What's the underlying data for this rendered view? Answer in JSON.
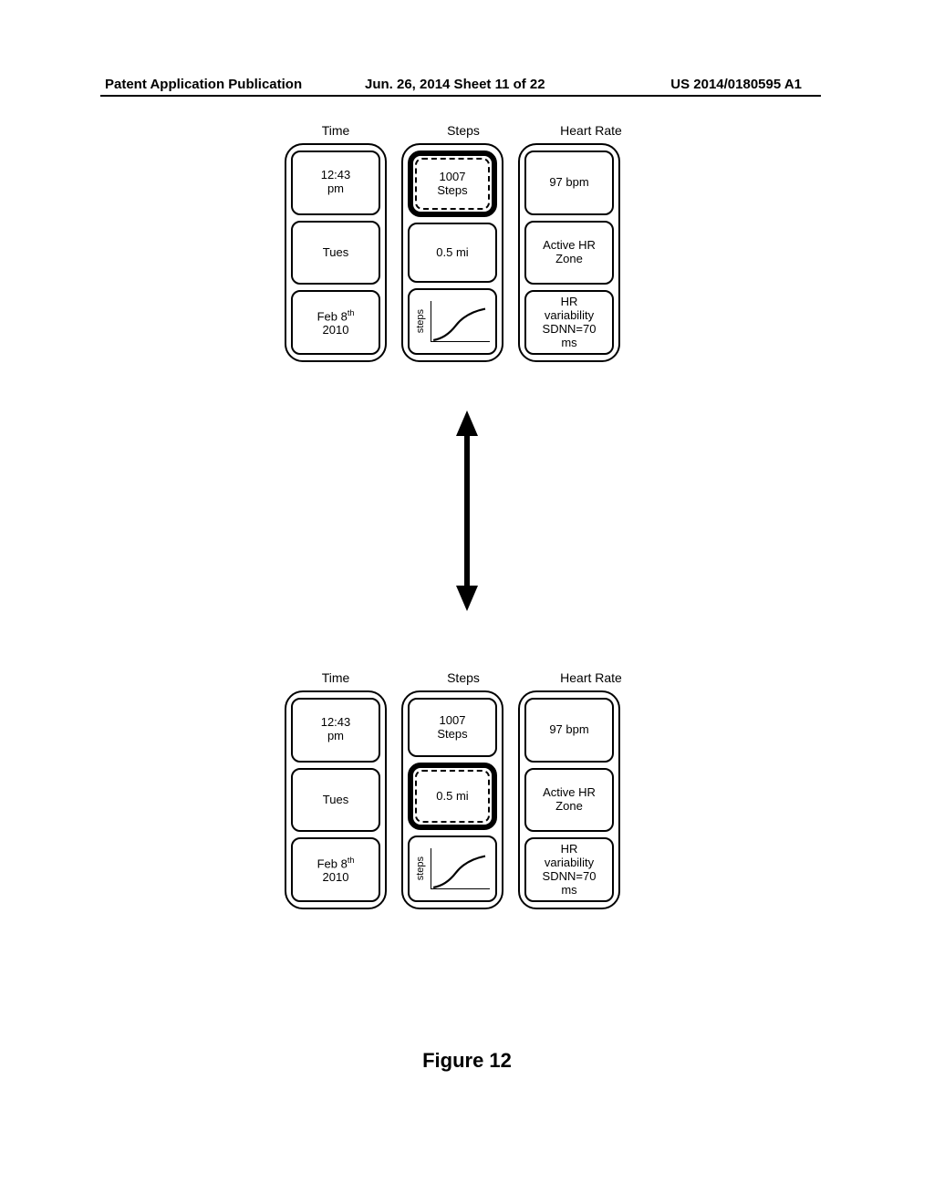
{
  "header": {
    "left": "Patent Application Publication",
    "mid": "Jun. 26, 2014  Sheet 11 of 22",
    "right": "US 2014/0180595 A1"
  },
  "columns": [
    "Time",
    "Steps",
    "Heart Rate"
  ],
  "cells": {
    "time": {
      "r1a": "12:43",
      "r1b": "pm",
      "r2": "Tues",
      "r3a": "Feb 8",
      "r3sup": "th",
      "r3b": "2010"
    },
    "steps": {
      "r1a": "1007",
      "r1b": "Steps",
      "r2": "0.5 mi",
      "chart_y": "steps"
    },
    "hr": {
      "r1": "97 bpm",
      "r2a": "Active HR",
      "r2b": "Zone",
      "r3a": "HR",
      "r3b": "variability",
      "r3c": "SDNN=70",
      "r3d": "ms"
    }
  },
  "chart_data": {
    "type": "line",
    "series": [
      {
        "name": "steps",
        "values": [
          5,
          15,
          30,
          45,
          55,
          58,
          60
        ]
      }
    ],
    "x": [
      0,
      1,
      2,
      3,
      4,
      5,
      6
    ],
    "xlabel": "",
    "ylabel": "steps",
    "title": ""
  },
  "figure_caption": "Figure 12"
}
